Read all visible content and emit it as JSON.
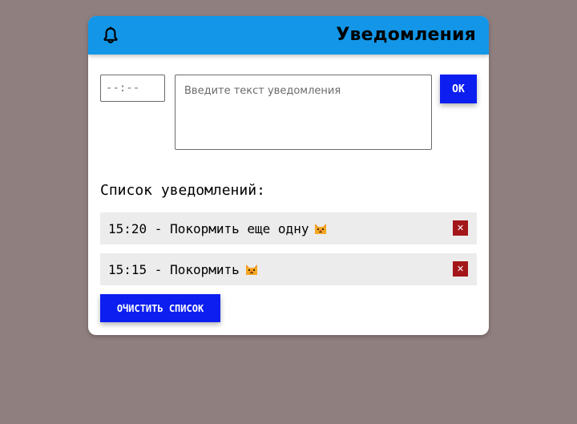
{
  "header": {
    "title": "Уведомления",
    "icon": "bell-icon",
    "background_color": "#1396e7"
  },
  "form": {
    "time_placeholder": "--:--",
    "text_placeholder": "Введите текст уведомления",
    "submit_label": "OK"
  },
  "list": {
    "heading": "Список уведомлений:",
    "items": [
      {
        "text": "15:20 - Покормить еще одну",
        "icon": "cat-face-icon",
        "delete_label": "✕"
      },
      {
        "text": "15:15 - Покормить",
        "icon": "cat-face-icon",
        "delete_label": "✕"
      }
    ]
  },
  "clear_label": "ОЧИСТИТЬ СПИСОК",
  "colors": {
    "page_background": "#907f7f",
    "primary_button": "#0c1ff0",
    "delete_button": "#a3161a",
    "list_item_background": "#ececec"
  }
}
